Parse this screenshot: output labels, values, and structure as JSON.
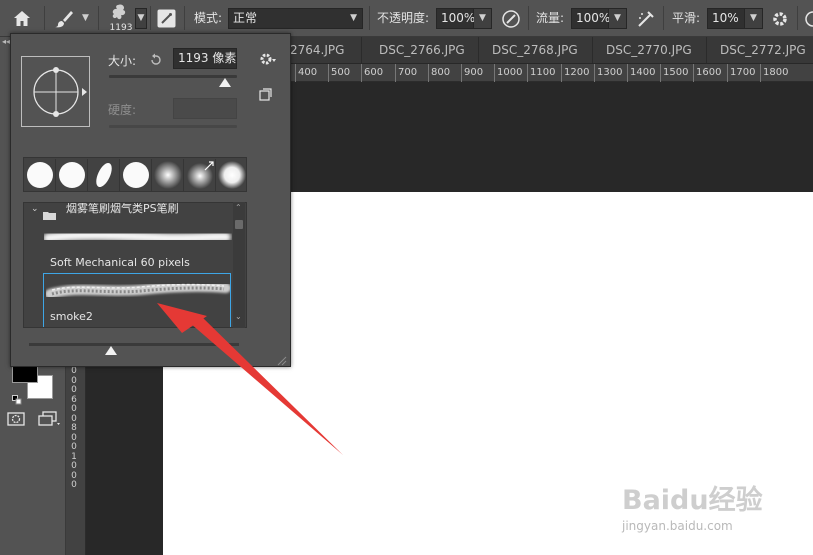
{
  "options_bar": {
    "brush_size_badge": "1193",
    "mode_label": "模式:",
    "mode_value": "正常",
    "opacity_label": "不透明度:",
    "opacity_value": "100%",
    "flow_label": "流量:",
    "flow_value": "100%",
    "smoothing_label": "平滑:",
    "smoothing_value": "10%"
  },
  "tabs": [
    {
      "label": "2764.JPG"
    },
    {
      "label": "DSC_2766.JPG"
    },
    {
      "label": "DSC_2768.JPG"
    },
    {
      "label": "DSC_2770.JPG"
    },
    {
      "label": "DSC_2772.JPG"
    }
  ],
  "ruler": {
    "horizontal": [
      "400",
      "500",
      "600",
      "700",
      "800",
      "900",
      "1000",
      "1100",
      "1200",
      "1300",
      "1400",
      "1500",
      "1600",
      "1700",
      "1800"
    ],
    "vertical_digits": [
      "0",
      "0",
      "0",
      "6",
      "0",
      "0",
      "8",
      "0",
      "0",
      "1",
      "0",
      "0",
      "0"
    ]
  },
  "brush_popup": {
    "size_label": "大小:",
    "size_value": "1193 像素",
    "hardness_label": "硬度:",
    "group_name": "烟雾笔刷烟气类PS笔刷",
    "brushes": [
      {
        "name": "Soft Mechanical 60 pixels"
      },
      {
        "name": "smoke2"
      }
    ]
  },
  "watermark": {
    "brand": "Baidu经验",
    "url": "jingyan.baidu.com"
  },
  "colors": {
    "foreground": "#000000",
    "background": "#ffffff",
    "accent": "#3ea6e6",
    "arrow": "#e53935"
  }
}
